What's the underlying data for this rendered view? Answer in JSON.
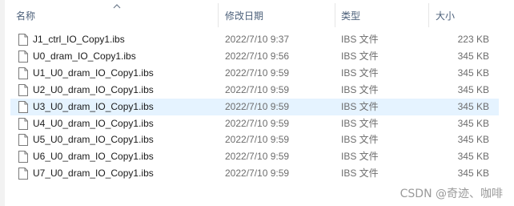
{
  "columns": {
    "name": "名称",
    "date": "修改日期",
    "type": "类型",
    "size": "大小"
  },
  "files": [
    {
      "name": "J1_ctrl_IO_Copy1.ibs",
      "date": "2022/7/10 9:37",
      "type": "IBS 文件",
      "size": "223 KB",
      "selected": false
    },
    {
      "name": "U0_dram_IO_Copy1.ibs",
      "date": "2022/7/10 9:56",
      "type": "IBS 文件",
      "size": "345 KB",
      "selected": false
    },
    {
      "name": "U1_U0_dram_IO_Copy1.ibs",
      "date": "2022/7/10 9:59",
      "type": "IBS 文件",
      "size": "345 KB",
      "selected": false
    },
    {
      "name": "U2_U0_dram_IO_Copy1.ibs",
      "date": "2022/7/10 9:59",
      "type": "IBS 文件",
      "size": "345 KB",
      "selected": false
    },
    {
      "name": "U3_U0_dram_IO_Copy1.ibs",
      "date": "2022/7/10 9:59",
      "type": "IBS 文件",
      "size": "345 KB",
      "selected": true
    },
    {
      "name": "U4_U0_dram_IO_Copy1.ibs",
      "date": "2022/7/10 9:59",
      "type": "IBS 文件",
      "size": "345 KB",
      "selected": false
    },
    {
      "name": "U5_U0_dram_IO_Copy1.ibs",
      "date": "2022/7/10 9:59",
      "type": "IBS 文件",
      "size": "345 KB",
      "selected": false
    },
    {
      "name": "U6_U0_dram_IO_Copy1.ibs",
      "date": "2022/7/10 9:59",
      "type": "IBS 文件",
      "size": "345 KB",
      "selected": false
    },
    {
      "name": "U7_U0_dram_IO_Copy1.ibs",
      "date": "2022/7/10 9:59",
      "type": "IBS 文件",
      "size": "345 KB",
      "selected": false
    }
  ],
  "watermark": "CSDN @奇迹、咖啡",
  "icons": {
    "file": "document-icon",
    "sort": "sort-ascending-icon"
  },
  "colors": {
    "header_text": "#4c607a",
    "selected_row": "#e5f3ff",
    "secondary_text": "#6d6d6d"
  }
}
